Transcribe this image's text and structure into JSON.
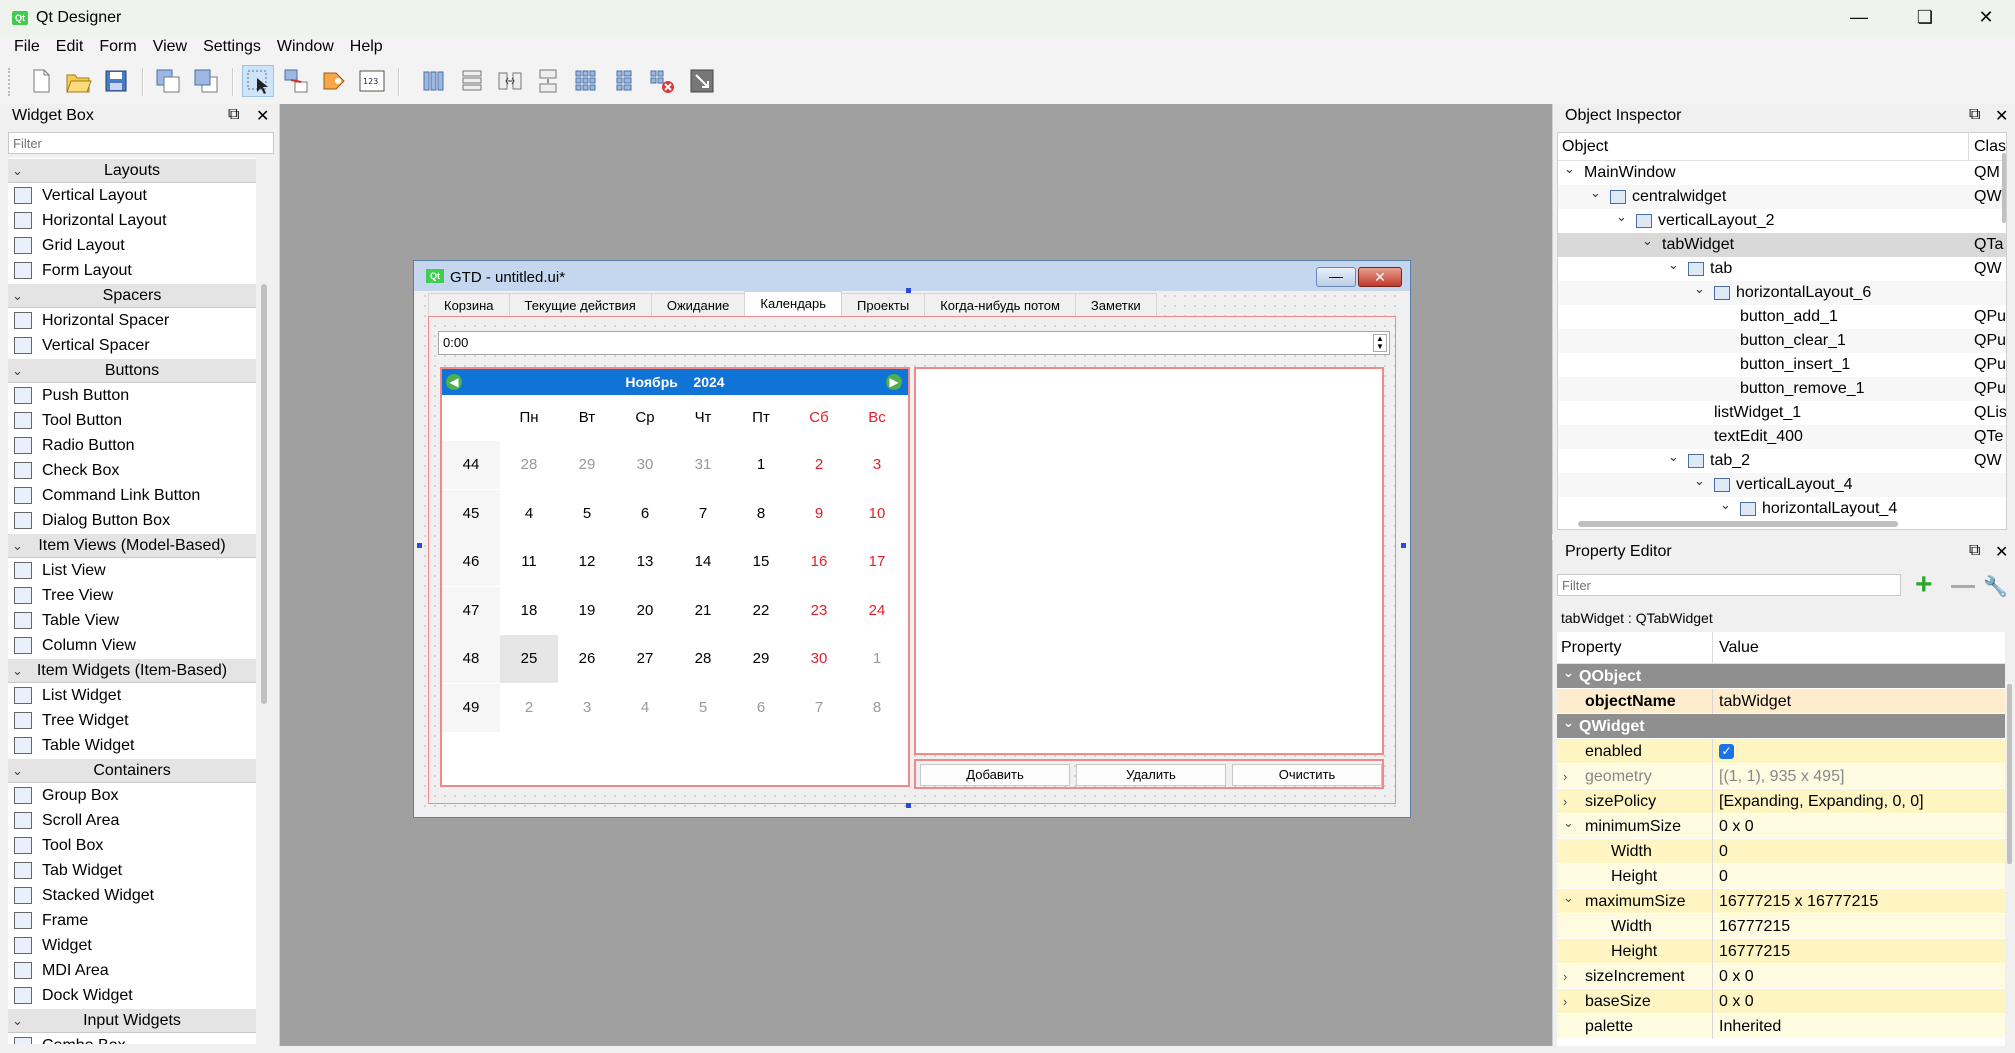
{
  "app": {
    "title": "Qt Designer",
    "icon_text": "Qt",
    "window_controls": [
      "minimize-icon",
      "restore-icon",
      "close-icon"
    ]
  },
  "menubar": [
    "File",
    "Edit",
    "Form",
    "View",
    "Settings",
    "Window",
    "Help"
  ],
  "toolbar_icons": [
    "new-form-icon",
    "open-form-icon",
    "save-form-icon",
    "send-to-back-icon",
    "bring-to-front-icon",
    "edit-widgets-icon",
    "edit-signals-slots-icon",
    "edit-buddies-icon",
    "edit-tab-order-icon",
    "lay-out-horizontally-icon",
    "lay-out-vertically-icon",
    "lay-out-horizontal-splitter-icon",
    "lay-out-vertical-splitter-icon",
    "lay-out-grid-icon",
    "lay-out-form-icon",
    "break-layout-icon",
    "adjust-size-icon"
  ],
  "widget_box": {
    "title": "Widget Box",
    "filter_placeholder": "Filter",
    "categories": [
      {
        "name": "Layouts",
        "items": [
          "Vertical Layout",
          "Horizontal Layout",
          "Grid Layout",
          "Form Layout"
        ]
      },
      {
        "name": "Spacers",
        "items": [
          "Horizontal Spacer",
          "Vertical Spacer"
        ]
      },
      {
        "name": "Buttons",
        "items": [
          "Push Button",
          "Tool Button",
          "Radio Button",
          "Check Box",
          "Command Link Button",
          "Dialog Button Box"
        ]
      },
      {
        "name": "Item Views (Model-Based)",
        "items": [
          "List View",
          "Tree View",
          "Table View",
          "Column View"
        ]
      },
      {
        "name": "Item Widgets (Item-Based)",
        "items": [
          "List Widget",
          "Tree Widget",
          "Table Widget"
        ]
      },
      {
        "name": "Containers",
        "items": [
          "Group Box",
          "Scroll Area",
          "Tool Box",
          "Tab Widget",
          "Stacked Widget",
          "Frame",
          "Widget",
          "MDI Area",
          "Dock Widget"
        ]
      },
      {
        "name": "Input Widgets",
        "items": [
          "Combo Box"
        ]
      }
    ]
  },
  "form": {
    "title": "GTD - untitled.ui*",
    "tabs": [
      "Корзина",
      "Текущие действия",
      "Ожидание",
      "Календарь",
      "Проекты",
      "Когда-нибудь потом",
      "Заметки"
    ],
    "active_tab": "Календарь",
    "time_value": "0:00",
    "calendar": {
      "month": "Ноябрь",
      "year": "2024",
      "weekdays": [
        "Пн",
        "Вт",
        "Ср",
        "Чт",
        "Пт",
        "Сб",
        "Вс"
      ],
      "weeks": [
        {
          "num": "44",
          "days": [
            "28",
            "29",
            "30",
            "31",
            "1",
            "2",
            "3"
          ]
        },
        {
          "num": "45",
          "days": [
            "4",
            "5",
            "6",
            "7",
            "8",
            "9",
            "10"
          ]
        },
        {
          "num": "46",
          "days": [
            "11",
            "12",
            "13",
            "14",
            "15",
            "16",
            "17"
          ]
        },
        {
          "num": "47",
          "days": [
            "18",
            "19",
            "20",
            "21",
            "22",
            "23",
            "24"
          ]
        },
        {
          "num": "48",
          "days": [
            "25",
            "26",
            "27",
            "28",
            "29",
            "30",
            "1"
          ]
        },
        {
          "num": "49",
          "days": [
            "2",
            "3",
            "4",
            "5",
            "6",
            "7",
            "8"
          ]
        }
      ],
      "selected_date": "25"
    },
    "buttons": [
      "Добавить",
      "Удалить",
      "Очистить"
    ]
  },
  "object_inspector": {
    "title": "Object Inspector",
    "col_object": "Object",
    "col_class": "Clas",
    "rows": [
      {
        "name": "MainWindow",
        "cls": "QM",
        "depth": 0,
        "expanded": true
      },
      {
        "name": "centralwidget",
        "cls": "QW",
        "depth": 1,
        "expanded": true,
        "icon": true
      },
      {
        "name": "verticalLayout_2",
        "cls": "",
        "depth": 2,
        "expanded": true,
        "icon": true
      },
      {
        "name": "tabWidget",
        "cls": "QTa",
        "depth": 3,
        "expanded": true,
        "selected": true
      },
      {
        "name": "tab",
        "cls": "QW",
        "depth": 4,
        "expanded": true,
        "icon": true
      },
      {
        "name": "horizontalLayout_6",
        "cls": "",
        "depth": 5,
        "expanded": true,
        "icon": true
      },
      {
        "name": "button_add_1",
        "cls": "QPu",
        "depth": 6
      },
      {
        "name": "button_clear_1",
        "cls": "QPu",
        "depth": 6
      },
      {
        "name": "button_insert_1",
        "cls": "QPu",
        "depth": 6
      },
      {
        "name": "button_remove_1",
        "cls": "QPu",
        "depth": 6
      },
      {
        "name": "listWidget_1",
        "cls": "QLis",
        "depth": 5
      },
      {
        "name": "textEdit_400",
        "cls": "QTe",
        "depth": 5
      },
      {
        "name": "tab_2",
        "cls": "QW",
        "depth": 4,
        "expanded": true,
        "icon": true
      },
      {
        "name": "verticalLayout_4",
        "cls": "",
        "depth": 5,
        "expanded": true,
        "icon": true
      },
      {
        "name": "horizontalLayout_4",
        "cls": "",
        "depth": 6,
        "expanded": true,
        "icon": true
      }
    ]
  },
  "property_editor": {
    "title": "Property Editor",
    "filter_placeholder": "Filter",
    "class_label": "tabWidget : QTabWidget",
    "col_property": "Property",
    "col_value": "Value",
    "rows": [
      {
        "type": "group",
        "name": "QObject"
      },
      {
        "type": "obj",
        "name": "objectName",
        "value": "tabWidget"
      },
      {
        "type": "group",
        "name": "QWidget"
      },
      {
        "type": "y1",
        "name": "enabled",
        "value": "",
        "checkbox": true
      },
      {
        "type": "y2",
        "name": "geometry",
        "value": "[(1, 1), 935 x 495]",
        "exp": "›",
        "dim": true
      },
      {
        "type": "y1",
        "name": "sizePolicy",
        "value": "[Expanding, Expanding, 0, 0]",
        "exp": "›"
      },
      {
        "type": "y2",
        "name": "minimumSize",
        "value": "0 x 0",
        "exp": "⌄"
      },
      {
        "type": "y1",
        "name": "Width",
        "value": "0",
        "sub": true
      },
      {
        "type": "y2",
        "name": "Height",
        "value": "0",
        "sub": true
      },
      {
        "type": "y1",
        "name": "maximumSize",
        "value": "16777215 x 16777215",
        "exp": "⌄"
      },
      {
        "type": "y2",
        "name": "Width",
        "value": "16777215",
        "sub": true
      },
      {
        "type": "y1",
        "name": "Height",
        "value": "16777215",
        "sub": true
      },
      {
        "type": "y2",
        "name": "sizeIncrement",
        "value": "0 x 0",
        "exp": "›"
      },
      {
        "type": "y1",
        "name": "baseSize",
        "value": "0 x 0",
        "exp": "›"
      },
      {
        "type": "y2",
        "name": "palette",
        "value": "Inherited"
      }
    ]
  }
}
